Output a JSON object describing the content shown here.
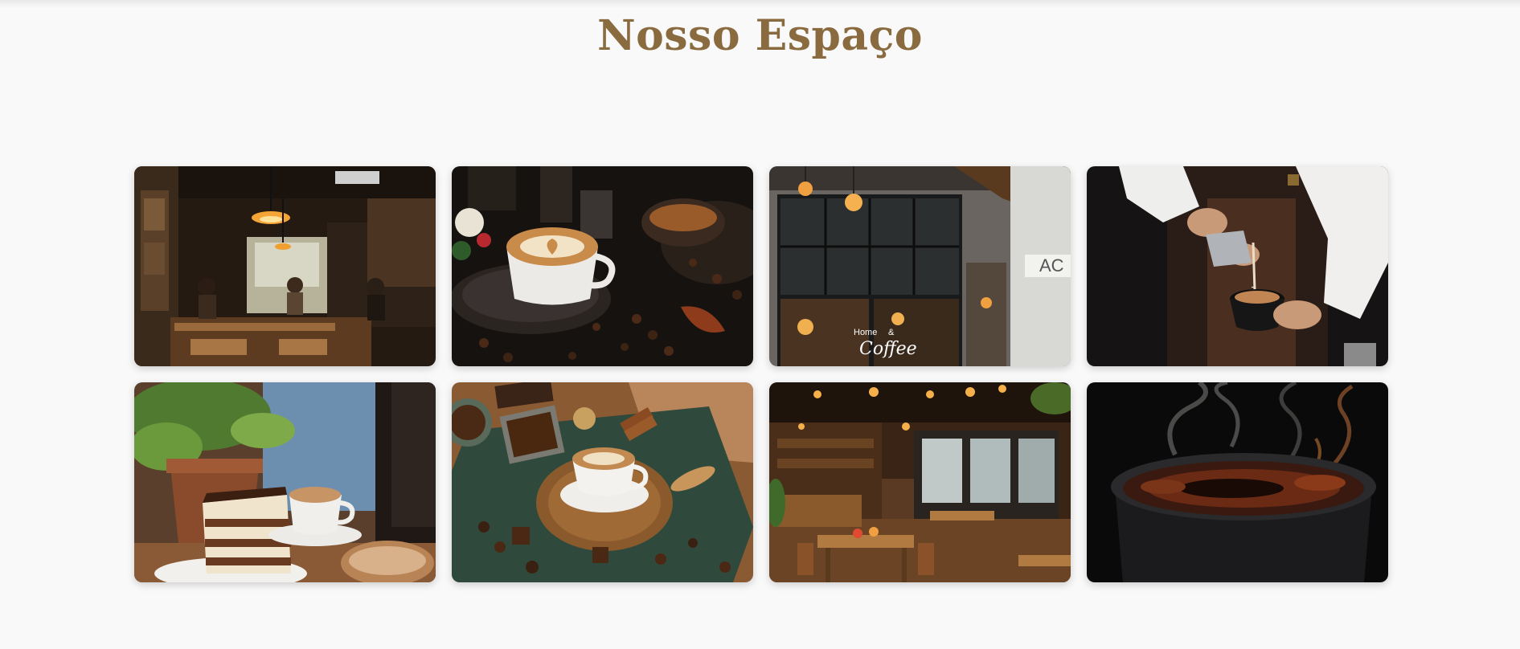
{
  "section": {
    "title": "Nosso Espaço"
  },
  "gallery": {
    "images": [
      {
        "name": "cafe-interior-evening-photo"
      },
      {
        "name": "latte-art-coffee-beans-photo"
      },
      {
        "name": "cafe-storefront-photo",
        "sign_lines": [
          "Home",
          "&",
          "Coffee"
        ],
        "facade_letters": "AC"
      },
      {
        "name": "barista-pouring-milk-photo"
      },
      {
        "name": "cake-and-coffee-photo"
      },
      {
        "name": "latte-on-table-with-spices-photo"
      },
      {
        "name": "cafe-dining-room-photo"
      },
      {
        "name": "steaming-black-coffee-photo"
      }
    ]
  },
  "colors": {
    "title": "#8a6b3f",
    "page_background": "#f9f9f9"
  }
}
